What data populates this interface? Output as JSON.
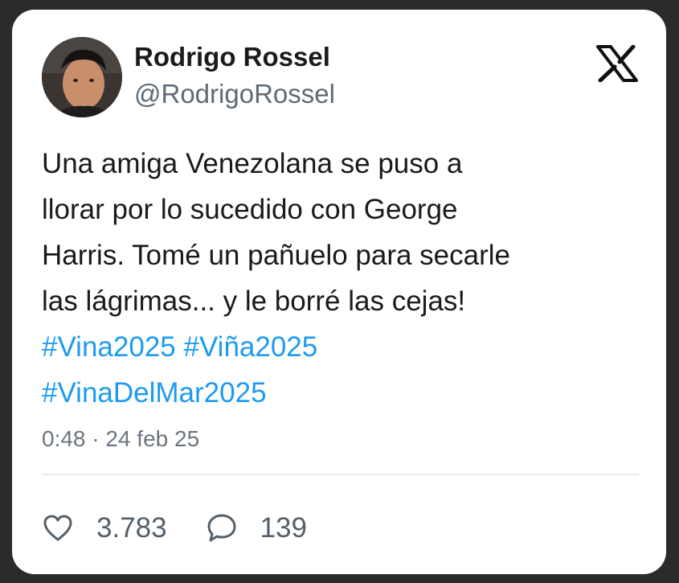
{
  "author": {
    "display_name": "Rodrigo Rossel",
    "handle": "@RodrigoRossel",
    "avatar_icon": "profile-photo"
  },
  "brand": {
    "logo_icon": "x-logo-icon"
  },
  "tweet": {
    "lines": [
      "Una amiga Venezolana se puso a",
      "llorar por lo sucedido con George",
      "Harris. Tomé un pañuelo para secarle",
      "las lágrimas... y le borré las cejas!"
    ],
    "hashtags_line1": [
      "#Vina2025",
      "#Viña2025"
    ],
    "hashtags_line2": [
      "#VinaDelMar2025"
    ],
    "hashtag_color": "#1d9bf0",
    "timestamp": "0:48 · 24 feb 25"
  },
  "actions": {
    "likes": "3.783",
    "replies": "139",
    "like_icon": "heart-icon",
    "reply_icon": "speech-bubble-icon"
  }
}
